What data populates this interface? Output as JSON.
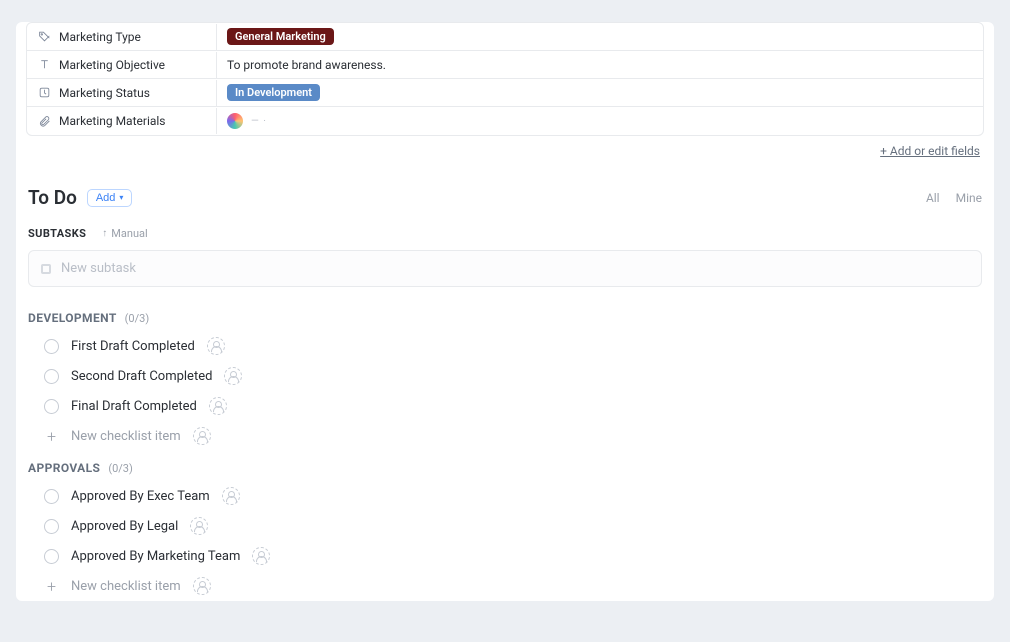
{
  "fields": [
    {
      "icon": "tag",
      "label": "Marketing Type",
      "valueType": "badge",
      "value": "General Marketing",
      "badgeClass": "badge-dark"
    },
    {
      "icon": "text",
      "label": "Marketing Objective",
      "valueType": "text",
      "value": "To promote brand awareness."
    },
    {
      "icon": "status",
      "label": "Marketing Status",
      "valueType": "badge",
      "value": "In Development",
      "badgeClass": "badge-blue"
    },
    {
      "icon": "attach",
      "label": "Marketing Materials",
      "valueType": "logo",
      "value": ""
    }
  ],
  "fields_footer": "+ Add or edit fields",
  "todo": {
    "title": "To Do",
    "add_label": "Add",
    "filters": {
      "all": "All",
      "mine": "Mine"
    }
  },
  "subtasks": {
    "label": "SUBTASKS",
    "sort": "Manual",
    "new_placeholder": "New subtask"
  },
  "checklists": [
    {
      "title": "DEVELOPMENT",
      "count": "(0/3)",
      "items": [
        "First Draft Completed",
        "Second Draft Completed",
        "Final Draft Completed"
      ],
      "new_label": "New checklist item"
    },
    {
      "title": "APPROVALS",
      "count": "(0/3)",
      "items": [
        "Approved By Exec Team",
        "Approved By Legal",
        "Approved By Marketing Team"
      ],
      "new_label": "New checklist item"
    }
  ]
}
